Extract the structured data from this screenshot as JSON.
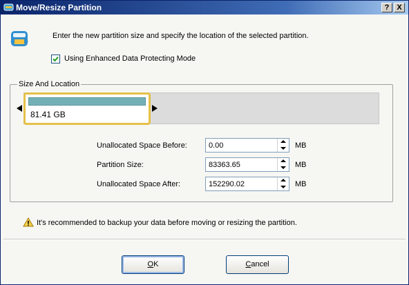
{
  "window": {
    "title": "Move/Resize Partition",
    "help_glyph": "?",
    "close_glyph": "X"
  },
  "instruction": "Enter the new partition size and specify the location of the selected partition.",
  "enhanced_mode": {
    "label": "Using Enhanced Data Protecting Mode",
    "checked": true
  },
  "size_location": {
    "legend": "Size And Location",
    "partition_label": "81.41 GB"
  },
  "fields": [
    {
      "label": "Unallocated Space Before:",
      "value": "0.00",
      "unit": "MB"
    },
    {
      "label": "Partition Size:",
      "value": "83363.65",
      "unit": "MB"
    },
    {
      "label": "Unallocated Space After:",
      "value": "152290.02",
      "unit": "MB"
    }
  ],
  "warning": "It's recommended to backup your data before moving or resizing the partition.",
  "buttons": {
    "ok": {
      "mnemonic": "O",
      "rest": "K"
    },
    "cancel": {
      "mnemonic": "C",
      "rest": "ancel"
    }
  },
  "colors": {
    "title_bar": "#0a246a",
    "partition_fill": "#73b0b6",
    "partition_border": "#e5c048"
  },
  "icons": [
    "app-icon",
    "help-icon",
    "close-icon",
    "check-icon",
    "warning-icon",
    "spin-up-icon",
    "spin-down-icon"
  ]
}
